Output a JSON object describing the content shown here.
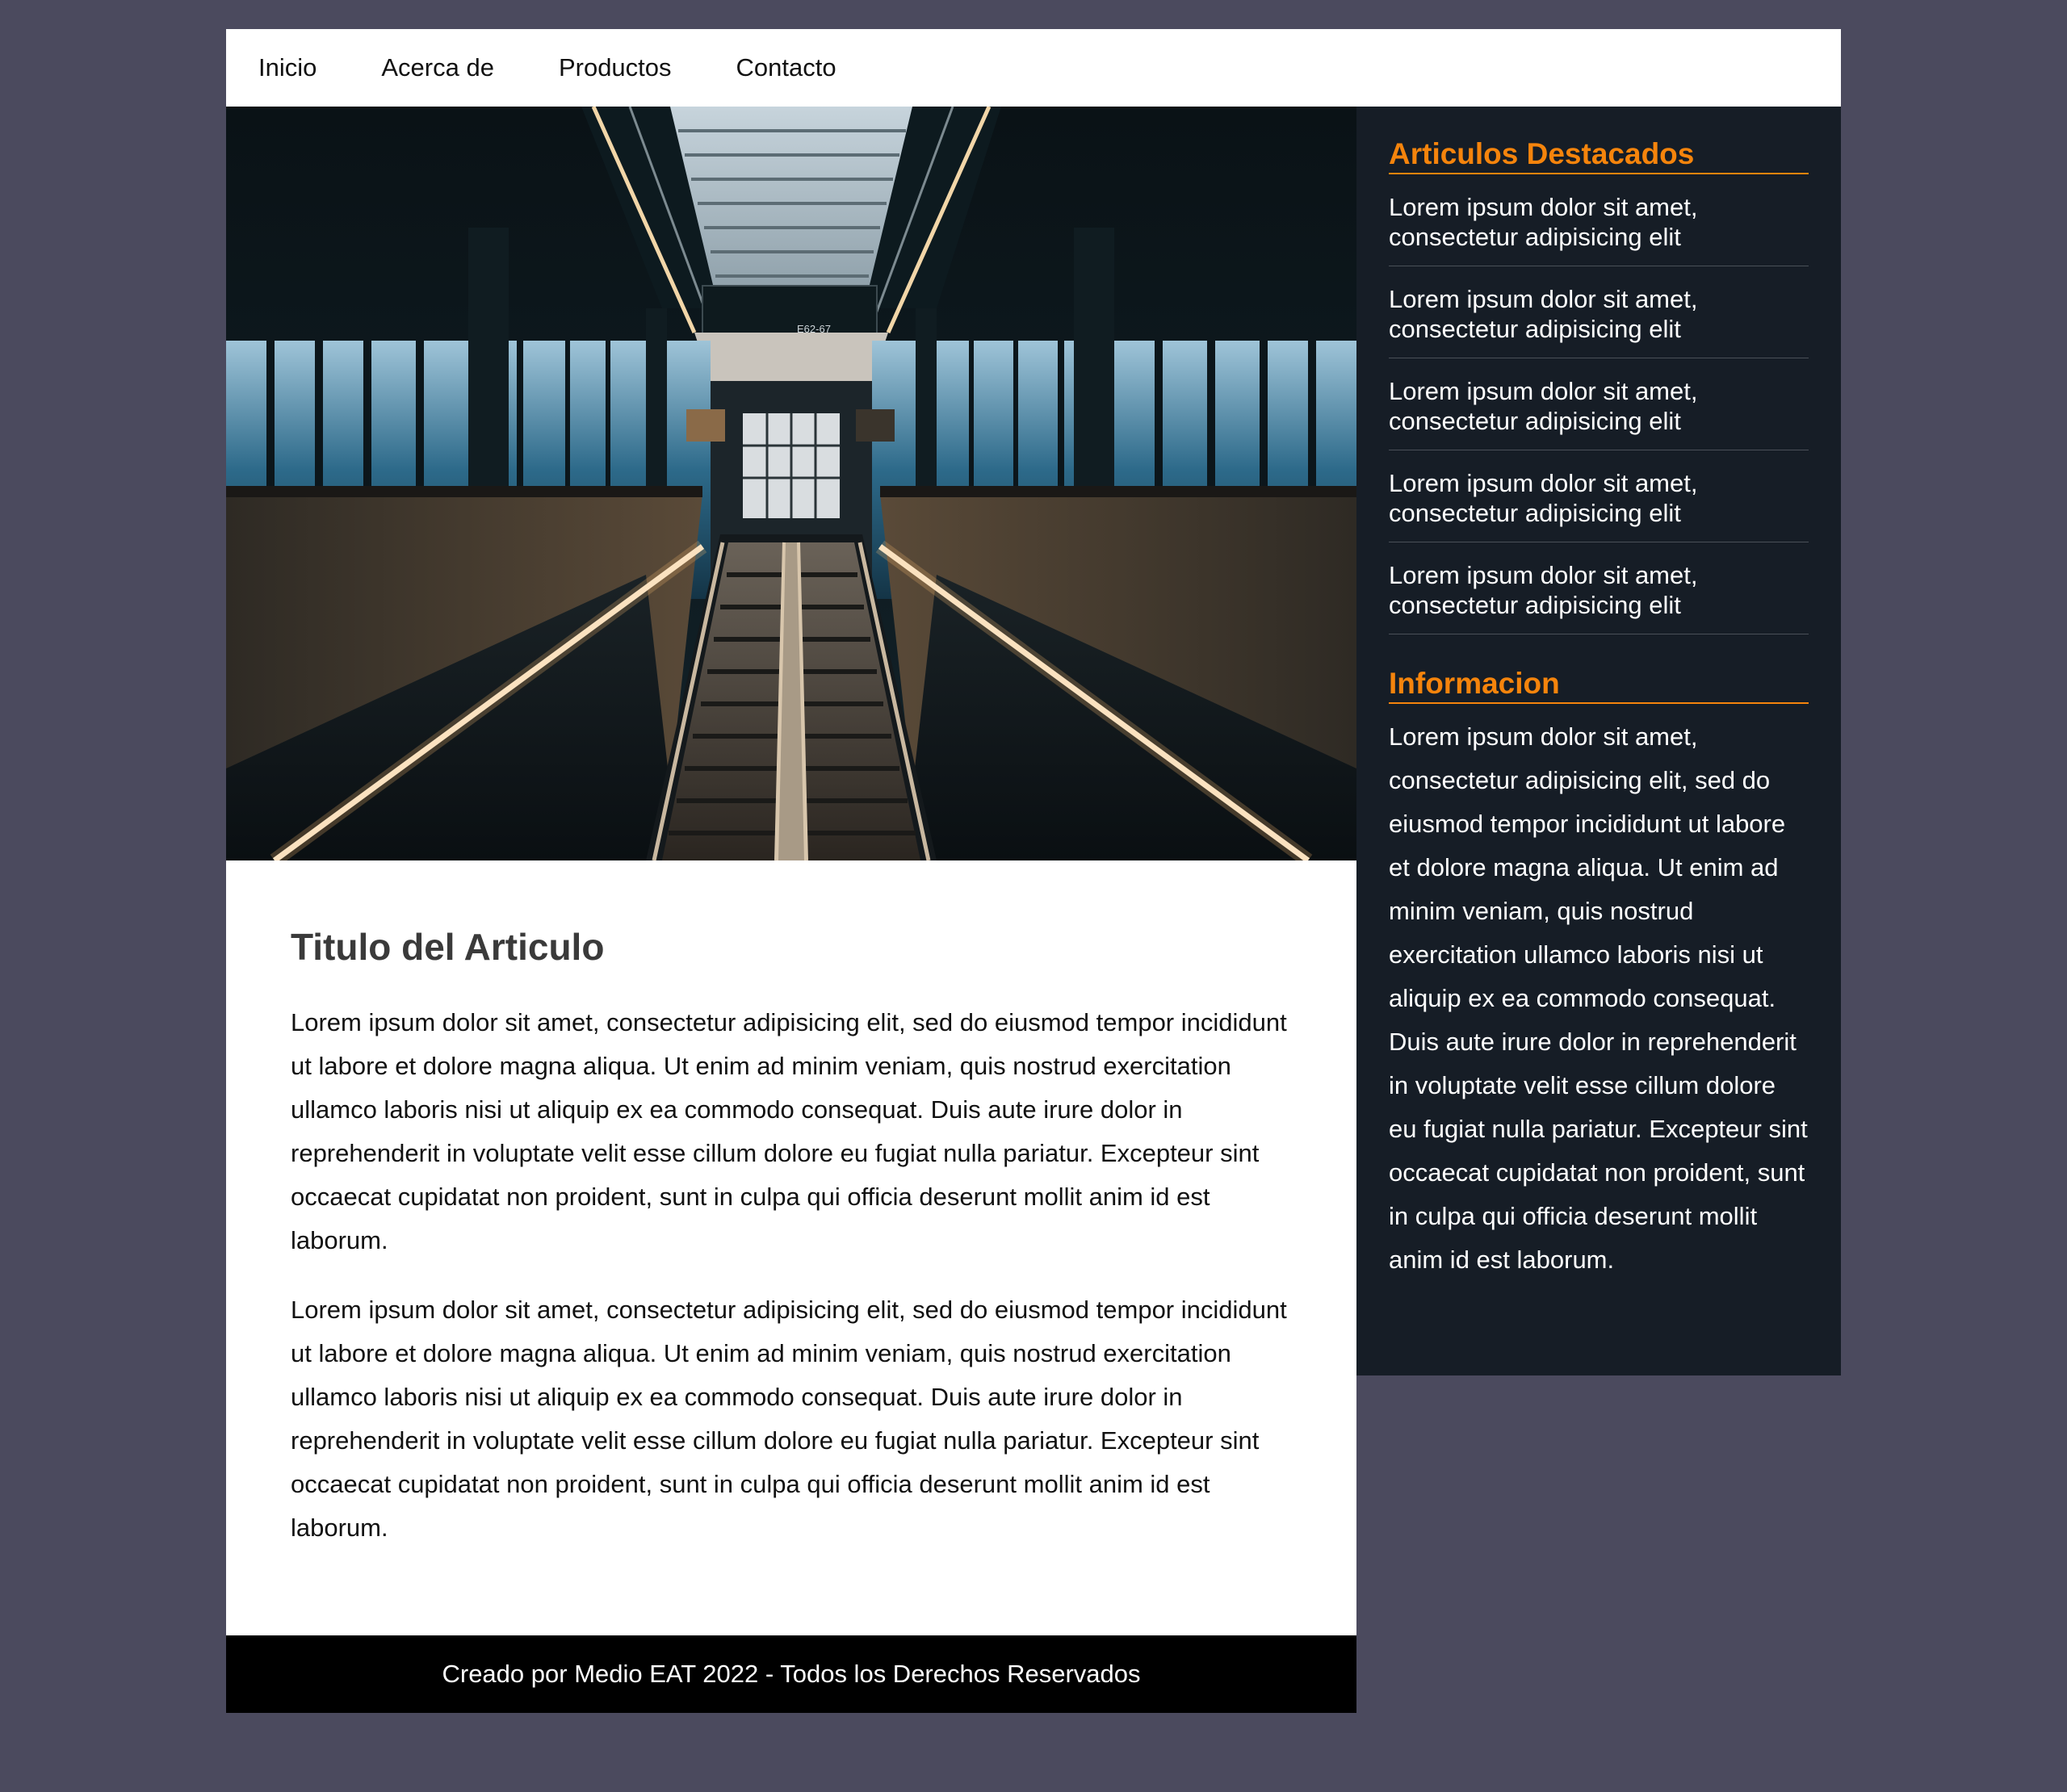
{
  "nav": {
    "items": [
      {
        "label": "Inicio"
      },
      {
        "label": "Acerca de"
      },
      {
        "label": "Productos"
      },
      {
        "label": "Contacto"
      }
    ]
  },
  "article": {
    "title": "Titulo del Articulo",
    "paragraphs": [
      "Lorem ipsum dolor sit amet, consectetur adipisicing elit, sed do eiusmod tempor incididunt ut labore et dolore magna aliqua. Ut enim ad minim veniam, quis nostrud exercitation ullamco laboris nisi ut aliquip ex ea commodo consequat. Duis aute irure dolor in reprehenderit in voluptate velit esse cillum dolore eu fugiat nulla pariatur. Excepteur sint occaecat cupidatat non proident, sunt in culpa qui officia deserunt mollit anim id est laborum.",
      "Lorem ipsum dolor sit amet, consectetur adipisicing elit, sed do eiusmod tempor incididunt ut labore et dolore magna aliqua. Ut enim ad minim veniam, quis nostrud exercitation ullamco laboris nisi ut aliquip ex ea commodo consequat. Duis aute irure dolor in reprehenderit in voluptate velit esse cillum dolore eu fugiat nulla pariatur. Excepteur sint occaecat cupidatat non proident, sunt in culpa qui officia deserunt mollit anim id est laborum."
    ]
  },
  "footer": {
    "text": "Creado por Medio EAT 2022 - Todos los Derechos Reservados"
  },
  "sidebar": {
    "featured_title": "Articulos Destacados",
    "featured_items": [
      {
        "text": "Lorem ipsum dolor sit amet, consectetur adipisicing elit"
      },
      {
        "text": "Lorem ipsum dolor sit amet, consectetur adipisicing elit"
      },
      {
        "text": "Lorem ipsum dolor sit amet, consectetur adipisicing elit"
      },
      {
        "text": "Lorem ipsum dolor sit amet, consectetur adipisicing elit"
      },
      {
        "text": "Lorem ipsum dolor sit amet, consectetur adipisicing elit"
      }
    ],
    "info_title": "Informacion",
    "info_text": "Lorem ipsum dolor sit amet, consectetur adipisicing elit, sed do eiusmod tempor incididunt ut labore et dolore magna aliqua. Ut enim ad minim veniam, quis nostrud exercitation ullamco laboris nisi ut aliquip ex ea commodo consequat. Duis aute irure dolor in reprehenderit in voluptate velit esse cillum dolore eu fugiat nulla pariatur. Excepteur sint occaecat cupidatat non proident, sunt in culpa qui officia deserunt mollit anim id est laborum."
  },
  "hero": {
    "sign_text": "E62-67"
  },
  "colors": {
    "page_background": "#4b4a5e",
    "accent": "#f5840c",
    "sidebar_background": "#161d26",
    "footer_background": "#000000"
  }
}
